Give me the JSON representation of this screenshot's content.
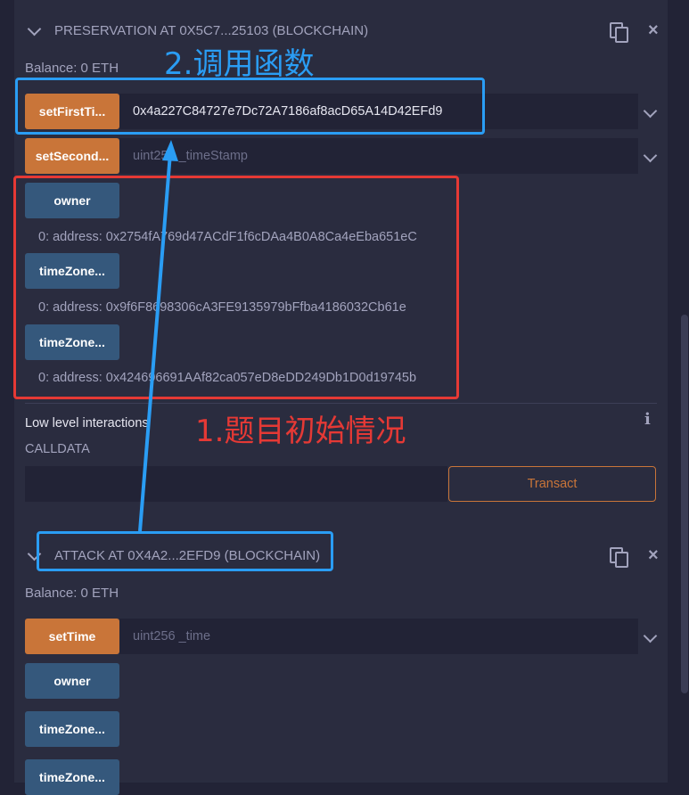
{
  "contracts": [
    {
      "header": "PRESERVATION AT 0X5C7...25103 (BLOCKCHAIN)",
      "balance": "Balance: 0 ETH",
      "functions": [
        {
          "label": "setFirstTi...",
          "kind": "transact",
          "input_value": "0x4a227C84727e7Dc72A7186af8acD65A14D42EFd9",
          "input_placeholder": ""
        },
        {
          "label": "setSecond...",
          "kind": "transact",
          "input_value": "",
          "input_placeholder": "uint256 _timeStamp"
        },
        {
          "label": "owner",
          "kind": "call",
          "result": "0: address: 0x2754fA769d47ACdF1f6cDAa4B0A8Ca4eEba651eC"
        },
        {
          "label": "timeZone...",
          "kind": "call",
          "result": "0: address: 0x9f6F8698306cA3FE9135979bFfba4186032Cb61e"
        },
        {
          "label": "timeZone...",
          "kind": "call",
          "result": "0: address: 0x424696691AAf82ca057eD8eDD249Db1D0d19745b"
        }
      ],
      "low_level": {
        "title": "Low level interactions",
        "calldata_label": "CALLDATA",
        "transact_label": "Transact"
      }
    },
    {
      "header": "ATTACK AT 0X4A2...2EFD9 (BLOCKCHAIN)",
      "balance": "Balance: 0 ETH",
      "functions": [
        {
          "label": "setTime",
          "kind": "transact",
          "input_value": "",
          "input_placeholder": "uint256 _time"
        },
        {
          "label": "owner",
          "kind": "call"
        },
        {
          "label": "timeZone...",
          "kind": "call"
        },
        {
          "label": "timeZone...",
          "kind": "call"
        }
      ]
    }
  ],
  "annotations": {
    "call_function": "2.调用函数",
    "initial_state": "1.题目初始情况"
  },
  "icons": {
    "collapse": "chevron-down-icon",
    "copy": "copy-icon",
    "close": "close-icon",
    "info": "info-icon"
  },
  "colors": {
    "transact_button": "#c97539",
    "call_button": "#35587c",
    "annotation_blue": "#2a9df4",
    "annotation_red": "#e53935"
  }
}
